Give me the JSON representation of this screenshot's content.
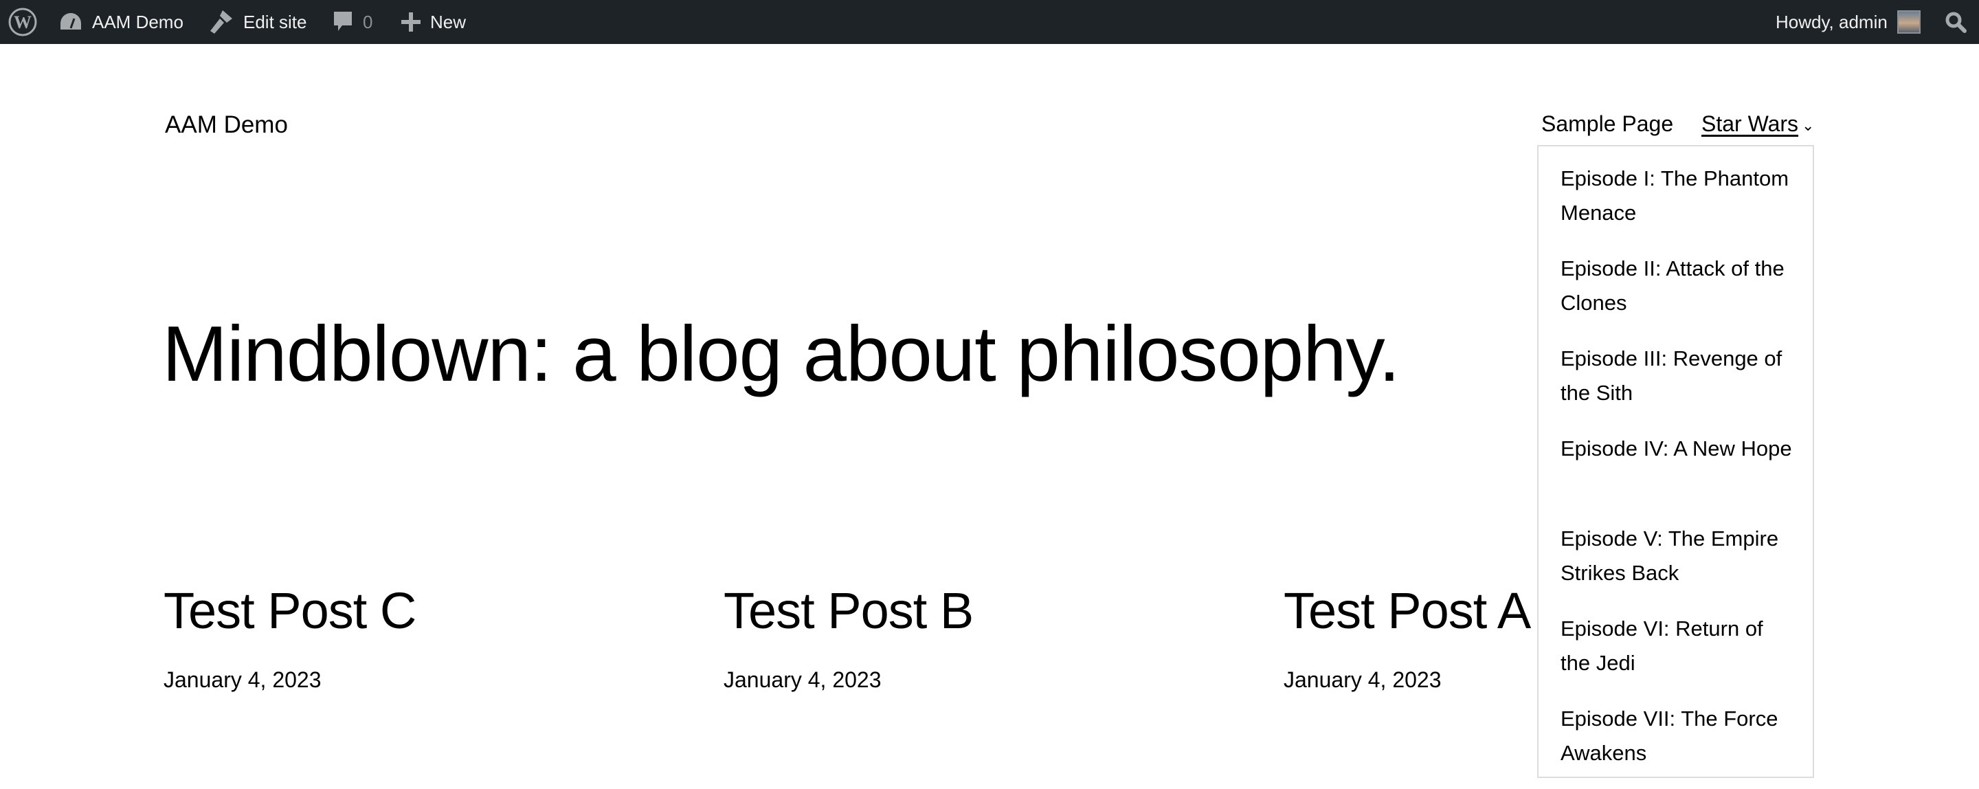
{
  "adminbar": {
    "site_name": "AAM Demo",
    "edit_site": "Edit site",
    "comments_count": "0",
    "new_label": "New",
    "howdy": "Howdy, admin"
  },
  "header": {
    "site_title": "AAM Demo",
    "nav": [
      {
        "label": "Sample Page"
      },
      {
        "label": "Star Wars"
      }
    ]
  },
  "dropdown": [
    "Episode I: The Phantom Menace",
    "Episode II: Attack of the Clones",
    "Episode III: Revenge of the Sith",
    "Episode IV: A New Hope",
    "Episode V: The Empire Strikes Back",
    "Episode VI: Return of the Jedi",
    "Episode VII: The Force Awakens"
  ],
  "main": {
    "headline": "Mindblown: a blog about philosophy.",
    "posts": [
      {
        "title": "Test Post C",
        "date": "January 4, 2023"
      },
      {
        "title": "Test Post B",
        "date": "January 4, 2023"
      },
      {
        "title": "Test Post A",
        "date": "January 4, 2023"
      }
    ]
  }
}
